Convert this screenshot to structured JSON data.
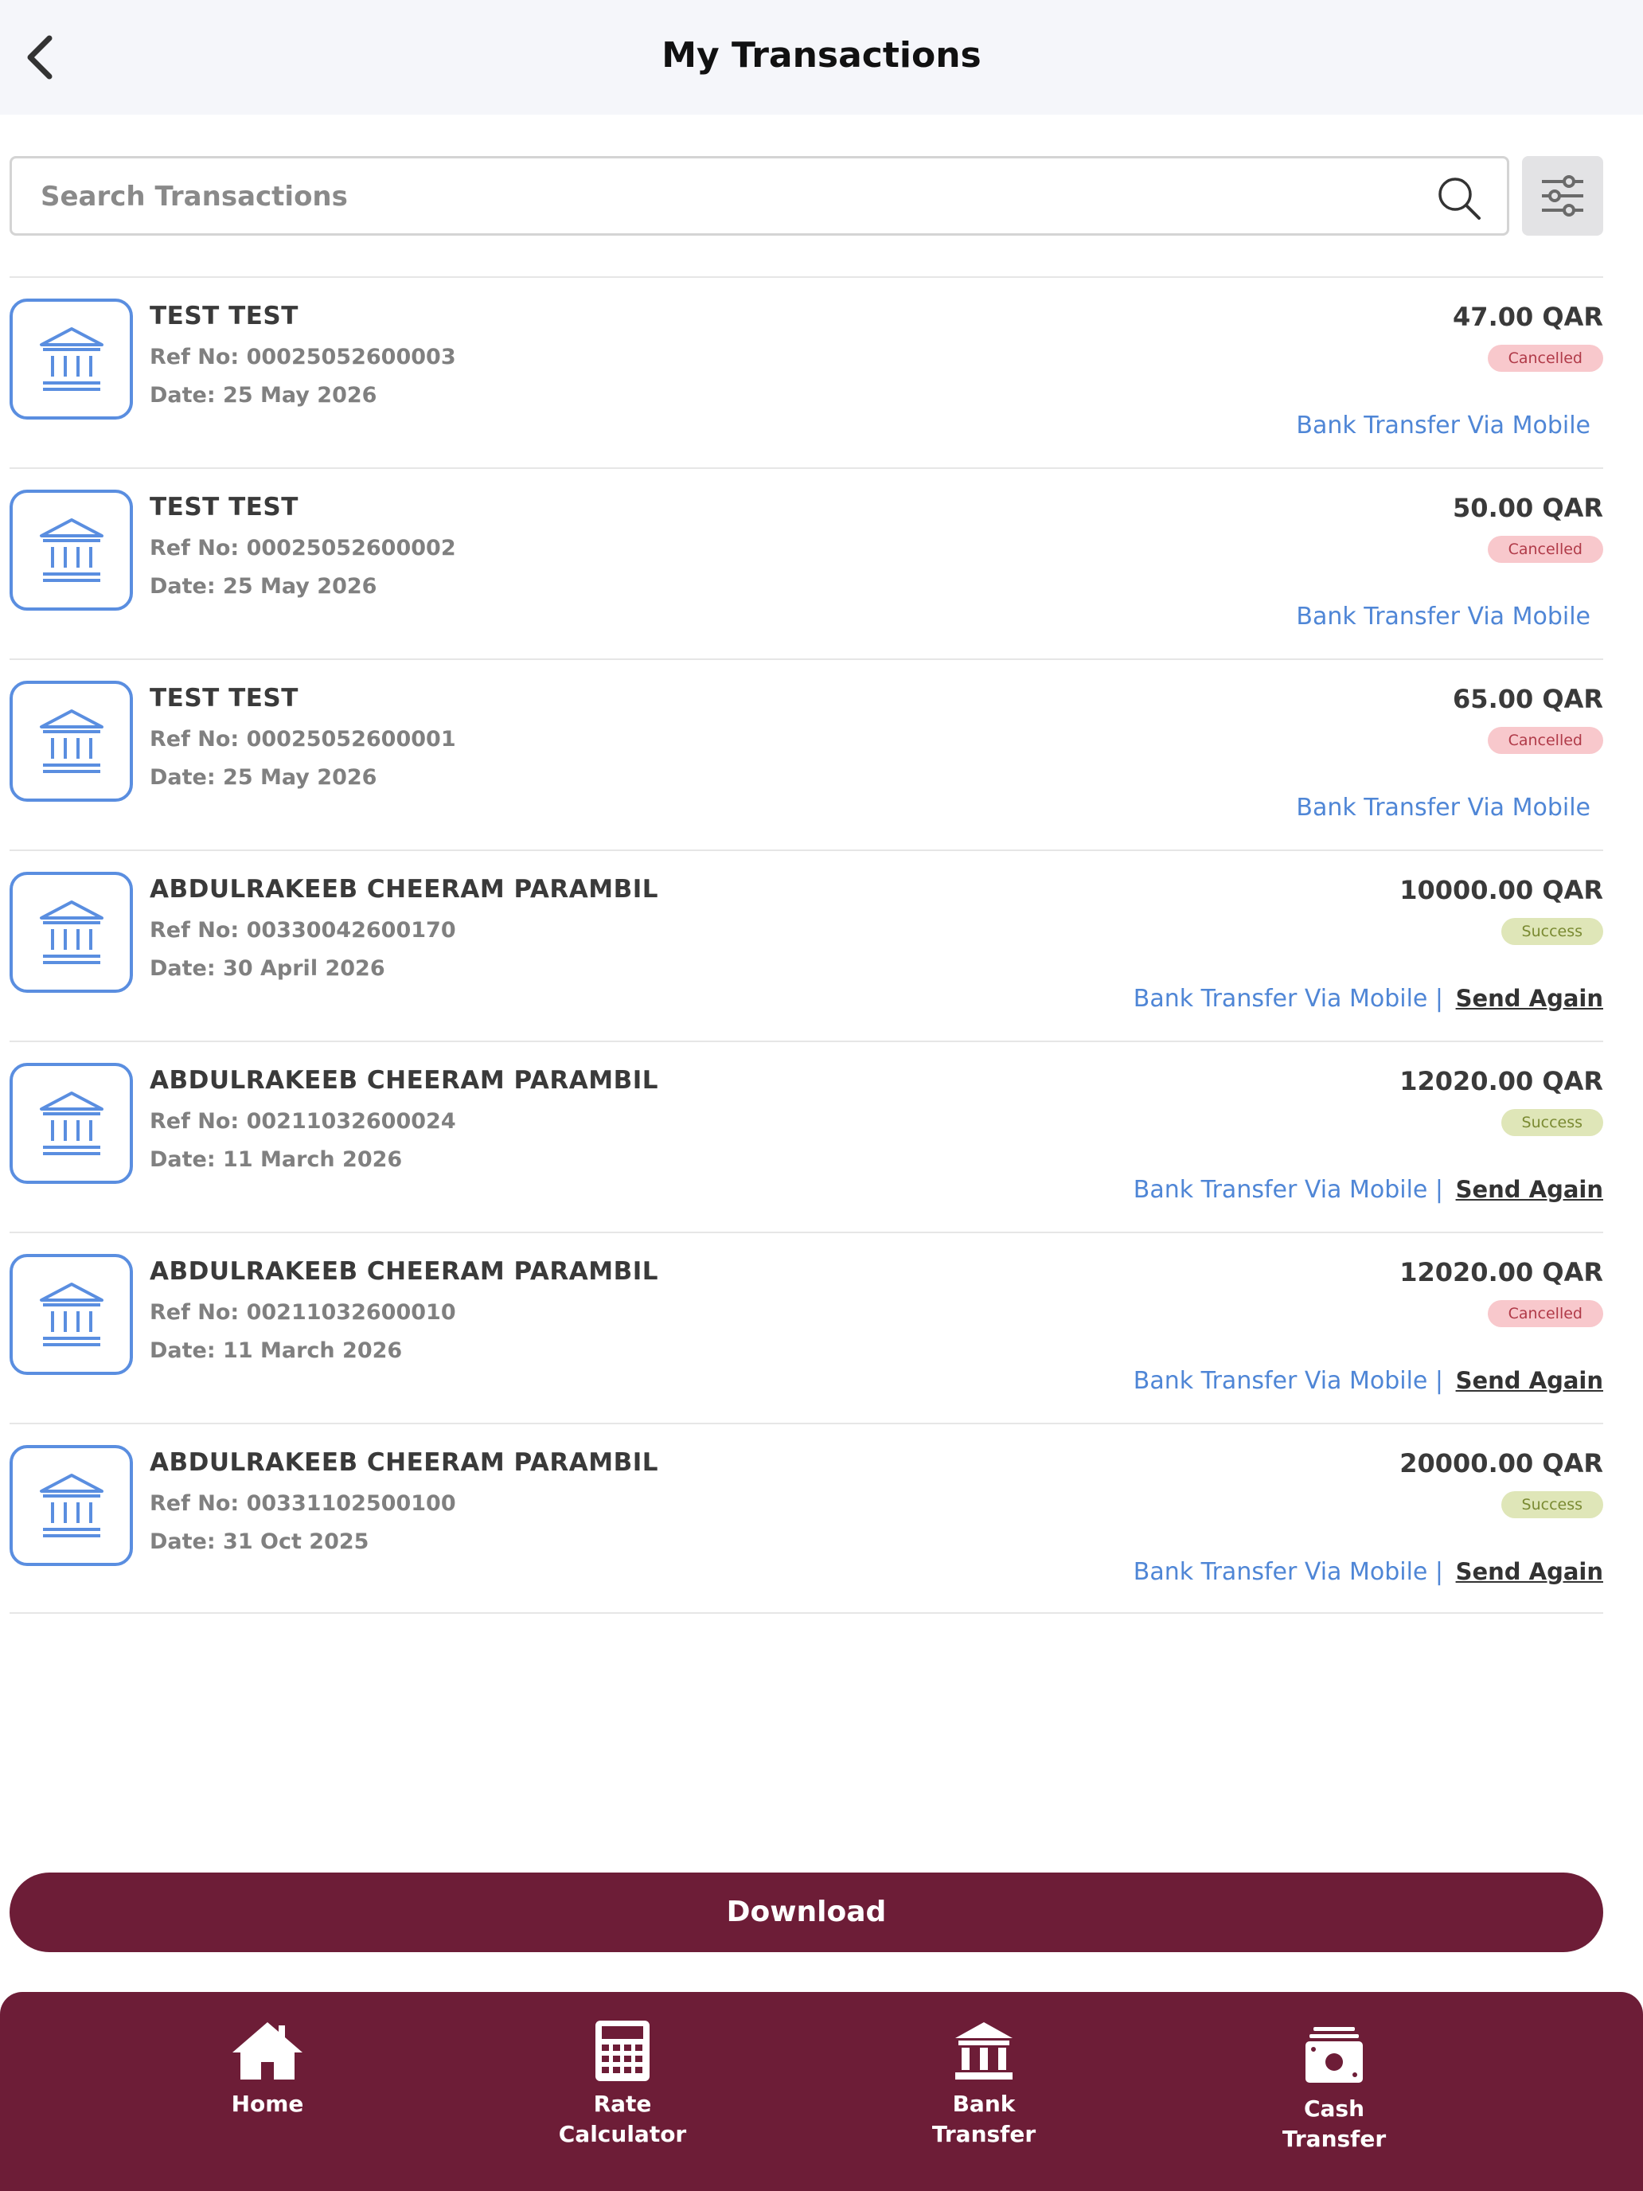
{
  "header": {
    "title": "My Transactions"
  },
  "search": {
    "placeholder": "Search Transactions"
  },
  "transactions": [
    {
      "name": "TEST TEST",
      "ref": "Ref No: 00025052600003",
      "date": "Date: 25 May 2026",
      "amount": "47.00 QAR",
      "status": "Cancelled",
      "method": "Bank Transfer Via Mobile",
      "send_again": ""
    },
    {
      "name": "TEST TEST",
      "ref": "Ref No: 00025052600002",
      "date": "Date: 25 May 2026",
      "amount": "50.00 QAR",
      "status": "Cancelled",
      "method": "Bank Transfer Via Mobile",
      "send_again": ""
    },
    {
      "name": "TEST TEST",
      "ref": "Ref No: 00025052600001",
      "date": "Date: 25 May 2026",
      "amount": "65.00 QAR",
      "status": "Cancelled",
      "method": "Bank Transfer Via Mobile",
      "send_again": ""
    },
    {
      "name": "ABDULRAKEEB CHEERAM PARAMBIL",
      "ref": "Ref No: 00330042600170",
      "date": "Date: 30 April 2026",
      "amount": "10000.00 QAR",
      "status": "Success",
      "method": "Bank Transfer Via Mobile |",
      "send_again": "Send Again"
    },
    {
      "name": "ABDULRAKEEB CHEERAM PARAMBIL",
      "ref": "Ref No: 00211032600024",
      "date": "Date: 11 March 2026",
      "amount": "12020.00 QAR",
      "status": "Success",
      "method": "Bank Transfer Via Mobile |",
      "send_again": "Send Again"
    },
    {
      "name": "ABDULRAKEEB CHEERAM PARAMBIL",
      "ref": "Ref No: 00211032600010",
      "date": "Date: 11 March 2026",
      "amount": "12020.00 QAR",
      "status": "Cancelled",
      "method": "Bank Transfer Via Mobile |",
      "send_again": "Send Again"
    },
    {
      "name": "ABDULRAKEEB CHEERAM PARAMBIL",
      "ref": "Ref No: 00331102500100",
      "date": "Date: 31 Oct 2025",
      "amount": "20000.00 QAR",
      "status": "Success",
      "method": "Bank Transfer Via Mobile |",
      "send_again": "Send Again"
    }
  ],
  "actions": {
    "download_label": "Download"
  },
  "bottom_nav": [
    {
      "label": "Home",
      "icon": "home-icon"
    },
    {
      "label": "Rate\nCalculator",
      "icon": "calculator-icon"
    },
    {
      "label": "Bank\nTransfer",
      "icon": "bank-icon"
    },
    {
      "label": "Cash\nTransfer",
      "icon": "cash-icon"
    }
  ],
  "colors": {
    "brand": "#6d1d37",
    "accent": "#4f86d6",
    "cancelled_bg": "#f8c8cc",
    "success_bg": "#dfe6b8"
  }
}
